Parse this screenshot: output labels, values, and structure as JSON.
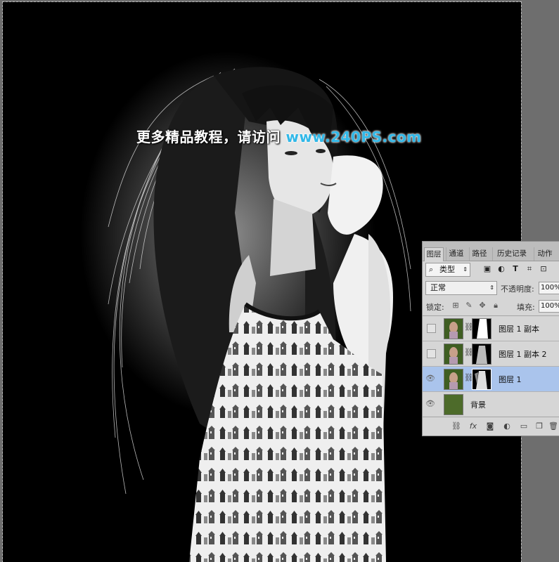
{
  "watermark": {
    "text_cn": "更多精品教程，请访问 ",
    "text_url": "www.240PS.com"
  },
  "layers_panel": {
    "tabs": [
      "图层",
      "通道",
      "路径",
      "历史记录",
      "动作"
    ],
    "active_tab": "图层",
    "kind_filter": {
      "icon": "search-icon",
      "label": "类型"
    },
    "filter_icons": [
      "image-filter-icon",
      "adjustment-filter-icon",
      "type-filter-icon",
      "shape-filter-icon",
      "smart-object-filter-icon"
    ],
    "blend_mode": "正常",
    "opacity_label": "不透明度:",
    "opacity_value": "100%",
    "lock_label": "锁定:",
    "lock_icons": [
      "lock-transparent-icon",
      "lock-image-icon",
      "lock-position-icon",
      "lock-all-icon"
    ],
    "fill_label": "填充:",
    "fill_value": "100%",
    "layers": [
      {
        "name": "图层 1 副本",
        "visible": false,
        "selected": false,
        "has_mask": true
      },
      {
        "name": "图层 1 副本 2",
        "visible": false,
        "selected": false,
        "has_mask": true
      },
      {
        "name": "图层 1",
        "visible": true,
        "selected": true,
        "has_mask": true
      },
      {
        "name": "背景",
        "visible": true,
        "selected": false,
        "has_mask": false
      }
    ],
    "bottom_icons": [
      "link-icon",
      "fx-icon",
      "add-mask-icon",
      "adjustment-layer-icon",
      "new-group-icon",
      "new-layer-icon",
      "delete-icon"
    ],
    "colors": {
      "selected_row": "#aac4ec",
      "background_swatch": "#4d6b2a",
      "panel_bg": "#d6d6d6"
    }
  }
}
